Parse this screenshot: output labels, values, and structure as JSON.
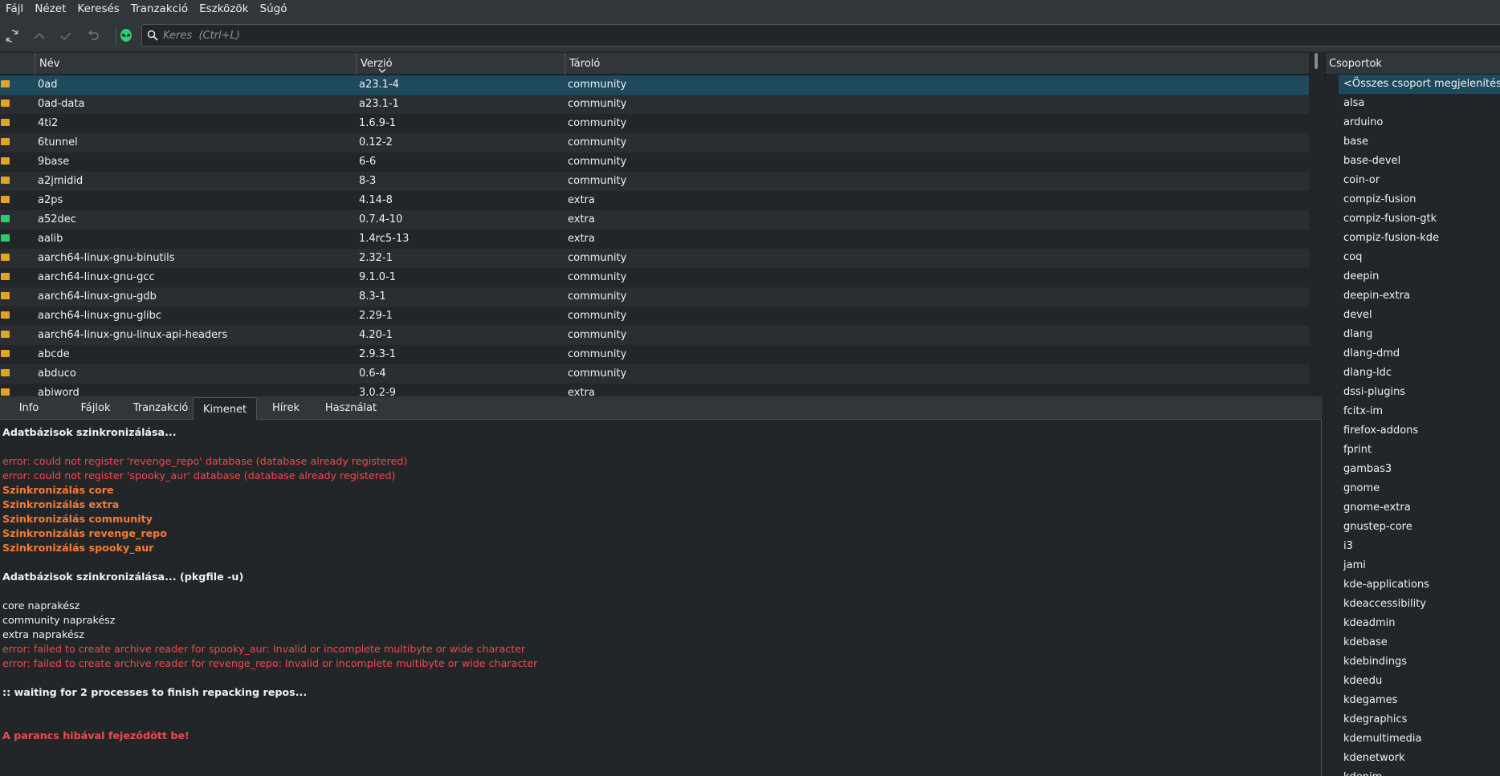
{
  "menubar": [
    "Fájl",
    "Nézet",
    "Keresés",
    "Tranzakció",
    "Eszközök",
    "Súgó"
  ],
  "search": {
    "placeholder": "Keres  (Ctrl+L)"
  },
  "table": {
    "headers": {
      "name": "Név",
      "version": "Verzió",
      "repo": "Tároló"
    },
    "rows": [
      {
        "name": "0ad",
        "version": "a23.1-4",
        "repo": "community",
        "status": "not-installed"
      },
      {
        "name": "0ad-data",
        "version": "a23.1-1",
        "repo": "community",
        "status": "not-installed"
      },
      {
        "name": "4ti2",
        "version": "1.6.9-1",
        "repo": "community",
        "status": "not-installed"
      },
      {
        "name": "6tunnel",
        "version": "0.12-2",
        "repo": "community",
        "status": "not-installed"
      },
      {
        "name": "9base",
        "version": "6-6",
        "repo": "community",
        "status": "not-installed"
      },
      {
        "name": "a2jmidid",
        "version": "8-3",
        "repo": "community",
        "status": "not-installed"
      },
      {
        "name": "a2ps",
        "version": "4.14-8",
        "repo": "extra",
        "status": "not-installed"
      },
      {
        "name": "a52dec",
        "version": "0.7.4-10",
        "repo": "extra",
        "status": "installed"
      },
      {
        "name": "aalib",
        "version": "1.4rc5-13",
        "repo": "extra",
        "status": "installed"
      },
      {
        "name": "aarch64-linux-gnu-binutils",
        "version": "2.32-1",
        "repo": "community",
        "status": "not-installed"
      },
      {
        "name": "aarch64-linux-gnu-gcc",
        "version": "9.1.0-1",
        "repo": "community",
        "status": "not-installed"
      },
      {
        "name": "aarch64-linux-gnu-gdb",
        "version": "8.3-1",
        "repo": "community",
        "status": "not-installed"
      },
      {
        "name": "aarch64-linux-gnu-glibc",
        "version": "2.29-1",
        "repo": "community",
        "status": "not-installed"
      },
      {
        "name": "aarch64-linux-gnu-linux-api-headers",
        "version": "4.20-1",
        "repo": "community",
        "status": "not-installed"
      },
      {
        "name": "abcde",
        "version": "2.9.3-1",
        "repo": "community",
        "status": "not-installed"
      },
      {
        "name": "abduco",
        "version": "0.6-4",
        "repo": "community",
        "status": "not-installed"
      },
      {
        "name": "abiword",
        "version": "3.0.2-9",
        "repo": "extra",
        "status": "not-installed"
      }
    ]
  },
  "tabs": [
    "Info",
    "Fájlok",
    "Tranzakció",
    "Kimenet",
    "Hírek",
    "Használat"
  ],
  "active_tab": "Kimenet",
  "output": [
    {
      "text": "Adatbázisok szinkronizálása...",
      "style": "wb"
    },
    {
      "text": "",
      "style": "gap"
    },
    {
      "text": "error: could not register 'revenge_repo' database (database already registered)",
      "style": "err"
    },
    {
      "text": "error: could not register 'spooky_aur' database (database already registered)",
      "style": "err"
    },
    {
      "text": "Szinkronizálás core",
      "style": "orb"
    },
    {
      "text": "Szinkronizálás extra",
      "style": "orb"
    },
    {
      "text": "Szinkronizálás community",
      "style": "orb"
    },
    {
      "text": "Szinkronizálás revenge_repo",
      "style": "orb"
    },
    {
      "text": "Szinkronizálás spooky_aur",
      "style": "orb"
    },
    {
      "text": "",
      "style": "gap"
    },
    {
      "text": "Adatbázisok szinkronizálása... (pkgfile -u)",
      "style": "wb"
    },
    {
      "text": "",
      "style": "gap"
    },
    {
      "text": "core naprakész",
      "style": "w"
    },
    {
      "text": "community naprakész",
      "style": "w"
    },
    {
      "text": "extra naprakész",
      "style": "w"
    },
    {
      "text": "error: failed to create archive reader for spooky_aur: Invalid or incomplete multibyte or wide character",
      "style": "err"
    },
    {
      "text": "error: failed to create archive reader for revenge_repo: Invalid or incomplete multibyte or wide character",
      "style": "err"
    },
    {
      "text": "",
      "style": "gap"
    },
    {
      "text": ":: waiting for 2 processes to finish repacking repos...",
      "style": "wb"
    },
    {
      "text": "",
      "style": "gap"
    },
    {
      "text": "",
      "style": "gap"
    },
    {
      "text": "A parancs hibával fejeződött be!",
      "style": "errb"
    }
  ],
  "groups": {
    "header": "Csoportok",
    "items": [
      "<Összes csoport megjelenítése>",
      "alsa",
      "arduino",
      "base",
      "base-devel",
      "coin-or",
      "compiz-fusion",
      "compiz-fusion-gtk",
      "compiz-fusion-kde",
      "coq",
      "deepin",
      "deepin-extra",
      "devel",
      "dlang",
      "dlang-dmd",
      "dlang-ldc",
      "dssi-plugins",
      "fcitx-im",
      "firefox-addons",
      "fprint",
      "gambas3",
      "gnome",
      "gnome-extra",
      "gnustep-core",
      "i3",
      "jami",
      "kde-applications",
      "kdeaccessibility",
      "kdeadmin",
      "kdebase",
      "kdebindings",
      "kdeedu",
      "kdegames",
      "kdegraphics",
      "kdemultimedia",
      "kdenetwork",
      "kdepim"
    ]
  },
  "colors": {
    "installed_icon": "#2ecc71",
    "not_installed_icon": "#e0a526",
    "selection": "#1e4a5e",
    "error": "#ed4b4b",
    "warning": "#f67b35"
  },
  "icons": {
    "refresh": "refresh-icon",
    "up": "chevron-up-icon",
    "commit": "check-icon",
    "rollback": "undo-icon",
    "aur": "alien-icon",
    "search": "search-icon"
  }
}
